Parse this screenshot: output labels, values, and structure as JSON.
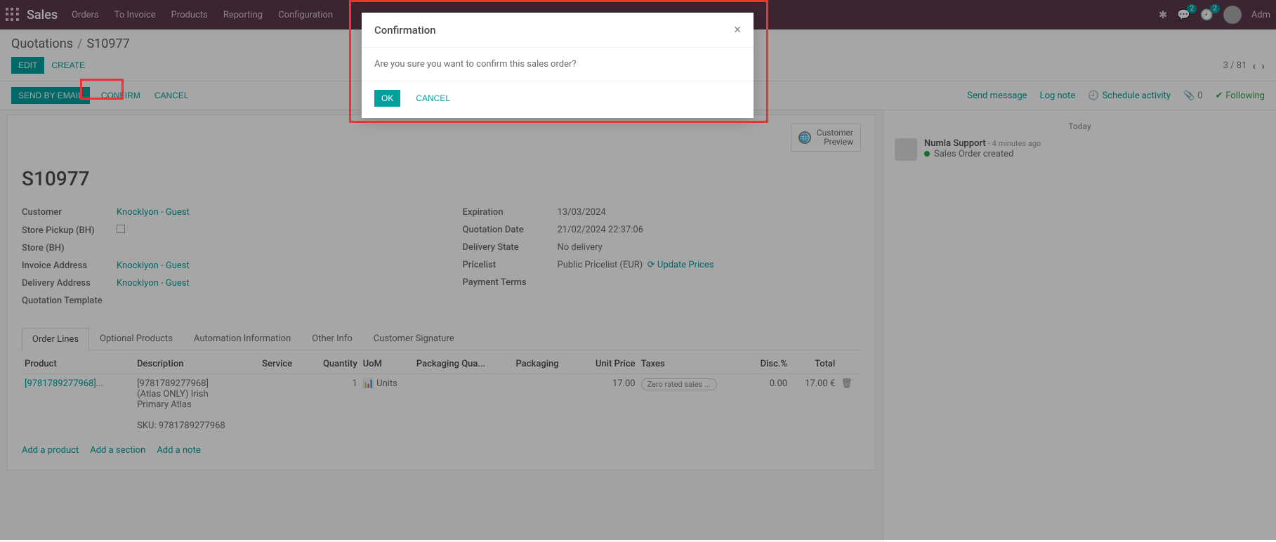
{
  "nav": {
    "brand": "Sales",
    "items": [
      "Orders",
      "To Invoice",
      "Products",
      "Reporting",
      "Configuration"
    ],
    "msg_badge": "2",
    "activity_badge": "2",
    "user": "Adm"
  },
  "breadcrumb": {
    "root": "Quotations",
    "current": "S10977"
  },
  "buttons": {
    "edit": "EDIT",
    "create": "CREATE"
  },
  "pager": {
    "text": "3 / 81"
  },
  "actionbar": {
    "send_email": "SEND BY EMAIL",
    "confirm": "CONFIRM",
    "cancel": "CANCEL",
    "send_msg": "Send message",
    "log_note": "Log note",
    "schedule": "Schedule activity",
    "attach_count": "0",
    "following": "Following"
  },
  "statbutton": {
    "line1": "Customer",
    "line2": "Preview"
  },
  "title": "S10977",
  "fields_left": {
    "customer_label": "Customer",
    "customer_val": "Knocklyon - Guest",
    "pickup_label": "Store Pickup (BH)",
    "store_label": "Store (BH)",
    "inv_label": "Invoice Address",
    "inv_val": "Knocklyon - Guest",
    "del_label": "Delivery Address",
    "del_val": "Knocklyon - Guest",
    "tmpl_label": "Quotation Template"
  },
  "fields_right": {
    "exp_label": "Expiration",
    "exp_val": "13/03/2024",
    "qd_label": "Quotation Date",
    "qd_val": "21/02/2024 22:37:06",
    "ds_label": "Delivery State",
    "ds_val": "No delivery",
    "pl_label": "Pricelist",
    "pl_val": "Public Pricelist (EUR)",
    "pl_link": "Update Prices",
    "pt_label": "Payment Terms"
  },
  "tabs": [
    "Order Lines",
    "Optional Products",
    "Automation Information",
    "Other Info",
    "Customer Signature"
  ],
  "table": {
    "headers": [
      "Product",
      "Description",
      "Service",
      "Quantity",
      "UoM",
      "Packaging Qua...",
      "Packaging",
      "Unit Price",
      "Taxes",
      "Disc.%",
      "Total",
      ""
    ],
    "row": {
      "product": "[9781789277968]...",
      "desc1": "[9781789277968] (Atlas ONLY) Irish Primary Atlas",
      "desc2": "SKU: 9781789277968",
      "qty": "1",
      "uom": "Units",
      "unit_price": "17.00",
      "tax": "Zero rated sales ...",
      "disc": "0.00",
      "total": "17.00 €"
    },
    "add_product": "Add a product",
    "add_section": "Add a section",
    "add_note": "Add a note"
  },
  "chatter": {
    "today": "Today",
    "author": "Numla Support",
    "time": "- 4 minutes ago",
    "body": "Sales Order created"
  },
  "modal": {
    "title": "Confirmation",
    "body": "Are you sure you want to confirm this sales order?",
    "ok": "OK",
    "cancel": "CANCEL"
  }
}
